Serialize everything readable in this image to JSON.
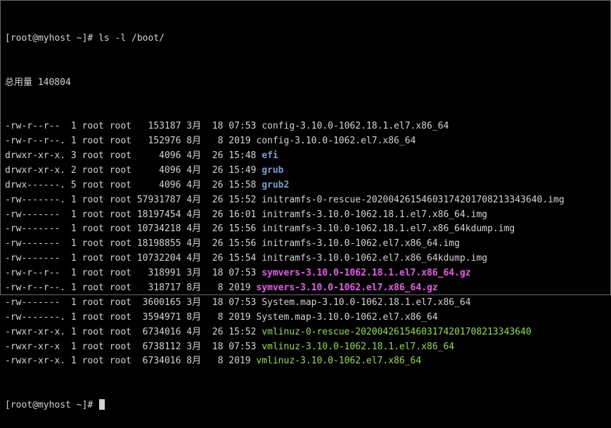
{
  "terminal": {
    "prompt": "[root@myhost ~]# ",
    "command": "ls -l /boot/",
    "total_line": "总用量 140804",
    "rows": [
      {
        "meta": "-rw-r--r--  1 root root   153187 3月  18 07:53 ",
        "name": "config-3.10.0-1062.18.1.el7.x86_64",
        "kind": "file"
      },
      {
        "meta": "-rw-r--r--. 1 root root   152976 8月   8 2019 ",
        "name": "config-3.10.0-1062.el7.x86_64",
        "kind": "file"
      },
      {
        "meta": "drwxr-xr-x. 3 root root     4096 4月  26 15:48 ",
        "name": "efi",
        "kind": "dir"
      },
      {
        "meta": "drwxr-xr-x. 2 root root     4096 4月  26 15:49 ",
        "name": "grub",
        "kind": "dir"
      },
      {
        "meta": "drwx------. 5 root root     4096 4月  26 15:58 ",
        "name": "grub2",
        "kind": "dir"
      },
      {
        "meta": "-rw-------. 1 root root 57931787 4月  26 15:52 ",
        "name": "initramfs-0-rescue-20200426154603174201708213343640.img",
        "kind": "file"
      },
      {
        "meta": "-rw-------  1 root root 18197454 4月  26 16:01 ",
        "name": "initramfs-3.10.0-1062.18.1.el7.x86_64.img",
        "kind": "file"
      },
      {
        "meta": "-rw-------  1 root root 10734218 4月  26 15:56 ",
        "name": "initramfs-3.10.0-1062.18.1.el7.x86_64kdump.img",
        "kind": "file"
      },
      {
        "meta": "-rw-------  1 root root 18198855 4月  26 15:56 ",
        "name": "initramfs-3.10.0-1062.el7.x86_64.img",
        "kind": "file"
      },
      {
        "meta": "-rw-------  1 root root 10732204 4月  26 15:54 ",
        "name": "initramfs-3.10.0-1062.el7.x86_64kdump.img",
        "kind": "file"
      },
      {
        "meta": "-rw-r--r--  1 root root   318991 3月  18 07:53 ",
        "name": "symvers-3.10.0-1062.18.1.el7.x86_64.gz",
        "kind": "archive"
      },
      {
        "meta": "-rw-r--r--. 1 root root   318717 8月   8 2019 ",
        "name": "symvers-3.10.0-1062.el7.x86_64.gz",
        "kind": "archive"
      },
      {
        "meta": "-rw-------  1 root root  3600165 3月  18 07:53 ",
        "name": "System.map-3.10.0-1062.18.1.el7.x86_64",
        "kind": "file"
      },
      {
        "meta": "-rw-------. 1 root root  3594971 8月   8 2019 ",
        "name": "System.map-3.10.0-1062.el7.x86_64",
        "kind": "file"
      },
      {
        "meta": "-rwxr-xr-x. 1 root root  6734016 4月  26 15:52 ",
        "name": "vmlinuz-0-rescue-20200426154603174201708213343640",
        "kind": "exec"
      },
      {
        "meta": "-rwxr-xr-x  1 root root  6738112 3月  18 07:53 ",
        "name": "vmlinuz-3.10.0-1062.18.1.el7.x86_64",
        "kind": "exec"
      },
      {
        "meta": "-rwxr-xr-x. 1 root root  6734016 8月   8 2019 ",
        "name": "vmlinuz-3.10.0-1062.el7.x86_64",
        "kind": "exec"
      }
    ],
    "colors": {
      "background": "#000000",
      "text": "#d3d3d3",
      "directory": "#729fcf",
      "archive": "#ee55ee",
      "executable": "#8ae234"
    }
  }
}
